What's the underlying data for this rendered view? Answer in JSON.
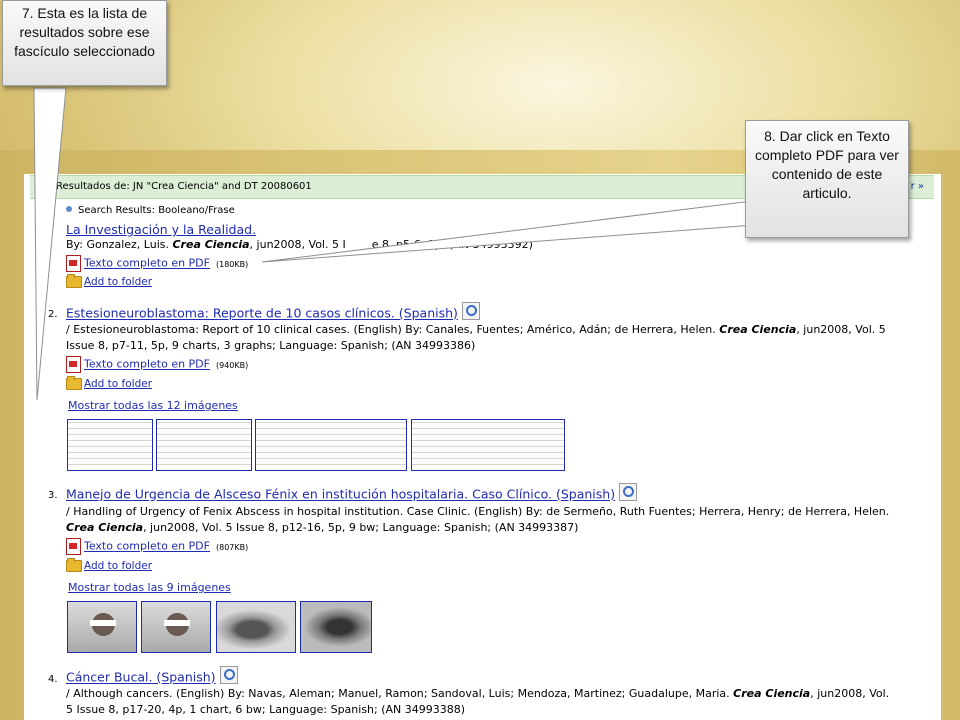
{
  "header": {
    "results_label": "Resultados de: JN \"Crea Ciencia\" and DT 20080601",
    "more_link": "r »"
  },
  "subhead": "Search Results: Booleano/Frase",
  "results": [
    {
      "number": "1.",
      "title": "La Investigación y la Realidad.",
      "meta_prefix": "By: Gonzalez, Luis.",
      "journal": "Crea Ciencia",
      "meta_suffix": ", jun2008, Vol. 5 I",
      "meta_tail": "e 8, p5-6, 1p; (AN 34993392)",
      "pdf_label": "Texto completo en PDF",
      "pdf_size": "(180KB)",
      "folder_label": "Add to folder"
    },
    {
      "number": "2.",
      "title": "Estesioneuroblastoma: Reporte de 10 casos clínicos. (Spanish)",
      "meta_line1_a": "/ Estesioneuroblastoma: Report of 10 clinical cases. (English) By: Canales, Fuentes; Américo, Adán; de Herrera, Helen.",
      "journal": "Crea Ciencia",
      "meta_line1_b": ", jun2008, Vol. 5",
      "meta_line2": "Issue 8, p7-11, 5p, 9 charts, 3 graphs; Language: Spanish; (AN 34993386)",
      "pdf_label": "Texto completo en PDF",
      "pdf_size": "(940KB)",
      "folder_label": "Add to folder",
      "show_all": "Mostrar todas las 12 imágenes"
    },
    {
      "number": "3.",
      "title": "Manejo de Urgencia de Alsceso Fénix en institución hospitalaria. Caso Clínico. (Spanish)",
      "meta_line1": "/ Handling of Urgency of Fenix Abscess in hospital institution. Case Clinic. (English) By: de Sermeño, Ruth Fuentes; Herrera, Henry; de Herrera, Helen.",
      "journal": "Crea Ciencia",
      "meta_line2": ", jun2008, Vol. 5 Issue 8, p12-16, 5p, 9 bw; Language: Spanish; (AN 34993387)",
      "pdf_label": "Texto completo en PDF",
      "pdf_size": "(807KB)",
      "folder_label": "Add to folder",
      "show_all": "Mostrar todas las 9 imágenes"
    },
    {
      "number": "4.",
      "title": "Cáncer Bucal. (Spanish)",
      "meta_line1_a": "/ Although cancers. (English) By: Navas, Aleman; Manuel, Ramon; Sandoval, Luis; Mendoza, Martinez; Guadalupe, Maria.",
      "journal": "Crea Ciencia",
      "meta_line1_b": ", jun2008, Vol.",
      "meta_line2": "5 Issue 8, p17-20, 4p, 1 chart, 6 bw; Language: Spanish; (AN 34993388)"
    }
  ],
  "callouts": {
    "step7": "7. Esta es la lista de resultados sobre ese fascículo seleccionado",
    "step8": "8. Dar click en Texto completo PDF para ver contenido de este articulo."
  },
  "icons": {
    "pdf": "pdf-icon",
    "folder": "folder-icon",
    "preview": "magnifier-preview-icon"
  }
}
